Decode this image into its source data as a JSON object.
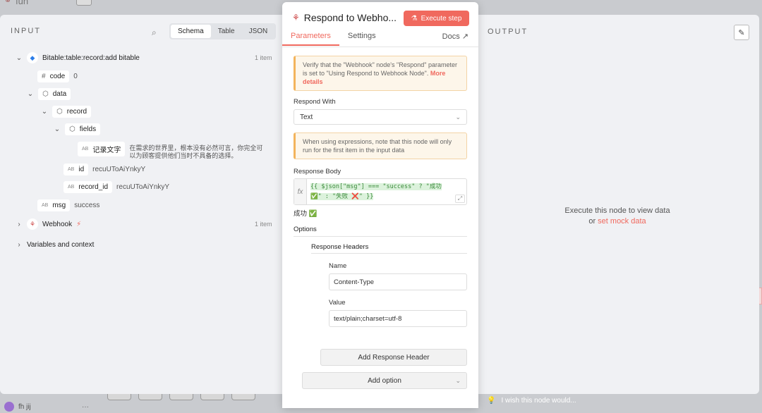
{
  "background": {
    "workflow_name": "fun",
    "user_name": "fh jij",
    "user_menu": "···",
    "footer_hint": "I wish this node would..."
  },
  "input_panel": {
    "title": "INPUT",
    "view_modes": [
      "Schema",
      "Table",
      "JSON"
    ],
    "active_view": "Schema",
    "nodes": [
      {
        "name": "Bitable:table:record:add bitable",
        "count": "1 item",
        "icon": "bitable-icon"
      },
      {
        "name": "Webhook",
        "count": "1 item",
        "icon": "webhook-icon"
      }
    ],
    "fields": {
      "code": {
        "key": "code",
        "value": "0",
        "type": "#"
      },
      "data": {
        "key": "data"
      },
      "record": {
        "key": "record"
      },
      "fields_obj": {
        "key": "fields"
      },
      "text_field": {
        "key": "记录文字",
        "value_line1": "在需求的世界里，根本没有必然可言，你完全可",
        "value_line2": "以为顾客提供他们当时不具备的选择。",
        "type": "AB"
      },
      "id": {
        "key": "id",
        "value": "recuUToAiYnkyY",
        "type": "AB"
      },
      "record_id": {
        "key": "record_id",
        "value": "recuUToAiYnkyY",
        "type": "AB"
      },
      "msg": {
        "key": "msg",
        "value": "success",
        "type": "AB"
      }
    },
    "variables_label": "Variables and context"
  },
  "node_panel": {
    "title": "Respond to Webho...",
    "execute_label": "Execute step",
    "tabs": [
      "Parameters",
      "Settings"
    ],
    "active_tab": "Parameters",
    "docs_label": "Docs",
    "notice1_text": "Verify that the \"Webhook\" node's \"Respond\" parameter is set to \"Using Respond to Webhook Node\".",
    "notice1_link": "More details",
    "respond_with_label": "Respond With",
    "respond_with_value": "Text",
    "notice2_text": "When using expressions, note that this node will only run for the first item in the input data",
    "response_body_label": "Response Body",
    "response_body_line1": "{{ $json[\"msg\"] === \"success\" ? \"成功",
    "response_body_line2": "✅\" : \"失败 ❌\" }}",
    "result_preview": "成功 ✅",
    "options_label": "Options",
    "response_headers_label": "Response Headers",
    "name_label": "Name",
    "name_value": "Content-Type",
    "value_label": "Value",
    "value_value": "text/plain;charset=utf-8",
    "add_header_label": "Add Response Header",
    "add_option_label": "Add option"
  },
  "output_panel": {
    "title": "OUTPUT",
    "empty_text": "Execute this node to view data",
    "or_text": "or",
    "mock_link": "set mock data"
  },
  "colors": {
    "accent": "#f0695e",
    "notice_border": "#f3b45c",
    "panel_bg": "#f0f1f4"
  }
}
